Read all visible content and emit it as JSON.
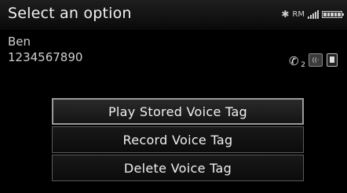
{
  "header": {
    "title": "Select an option",
    "status": {
      "bluetooth_icon": "bluetooth-icon",
      "roaming": "RM",
      "signal_icon": "signal-bars-icon",
      "battery_icon": "battery-icon"
    }
  },
  "contact": {
    "name": "Ben",
    "number": "1234567890",
    "phone_slot": "2"
  },
  "menu": {
    "items": [
      {
        "label": "Play Stored Voice Tag"
      },
      {
        "label": "Record Voice Tag"
      },
      {
        "label": "Delete Voice Tag"
      }
    ]
  }
}
